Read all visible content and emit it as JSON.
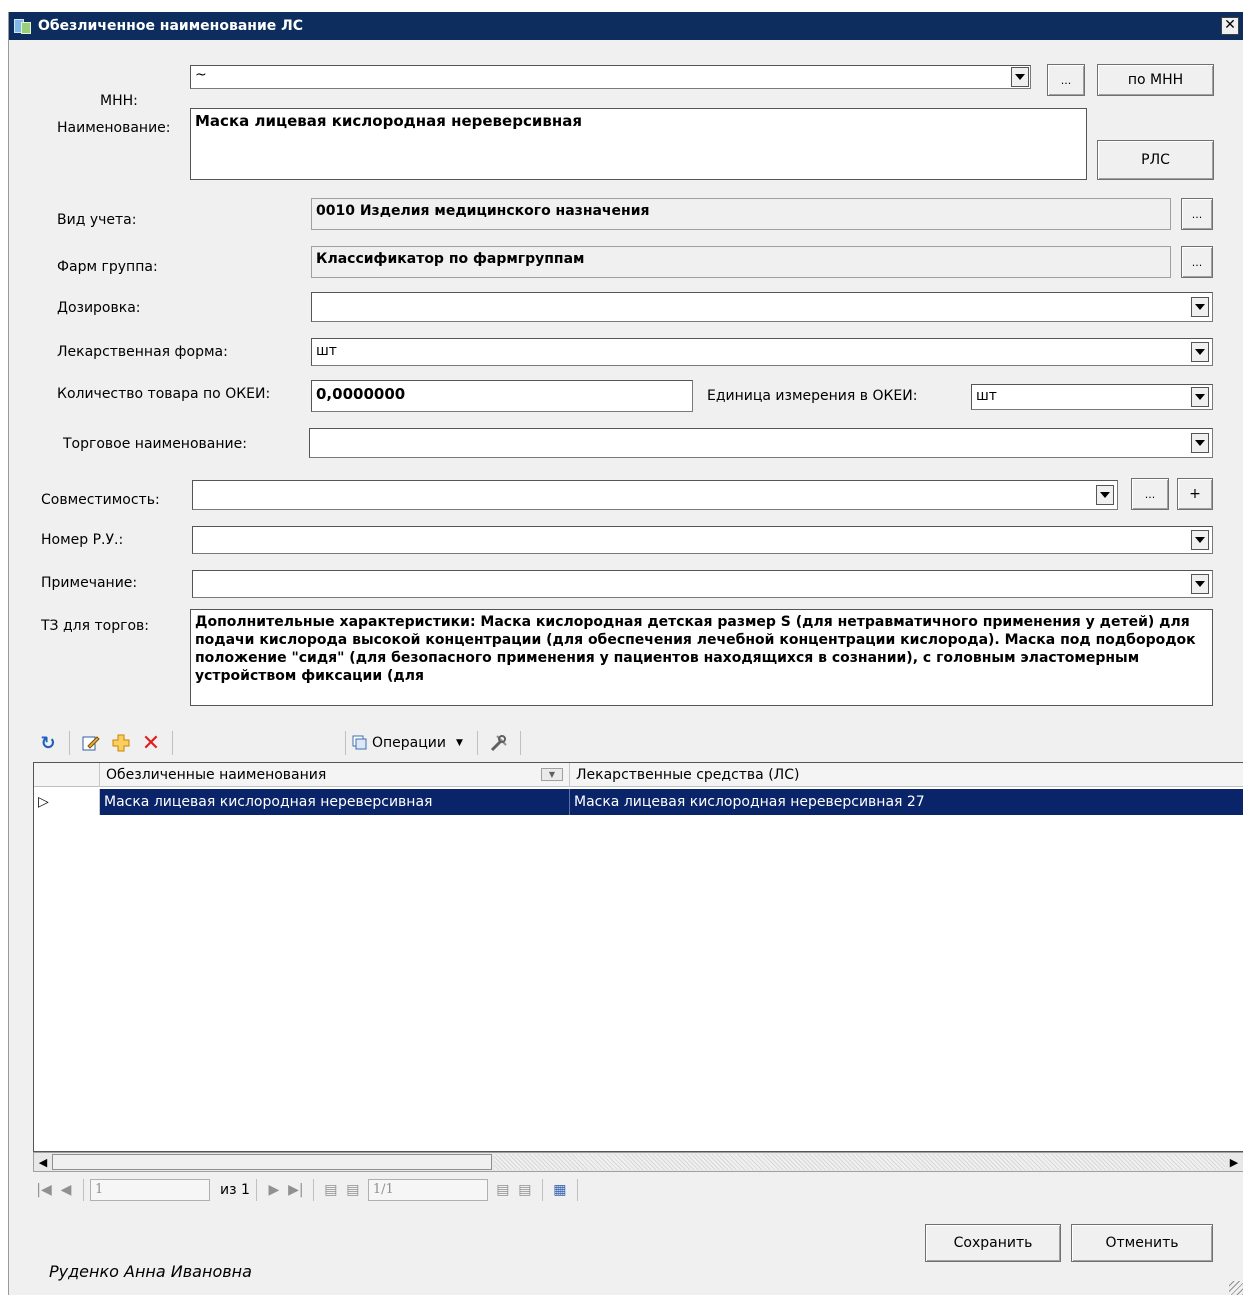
{
  "window": {
    "title": "Обезличенное наименование ЛС",
    "close": "✕"
  },
  "form": {
    "mnn": {
      "label": "МНН:",
      "value": "~",
      "browse": "...",
      "button": "по МНН"
    },
    "name": {
      "label": "Наименование:",
      "value": "Маска лицевая кислородная нереверсивная",
      "button": "РЛС"
    },
    "account_type": {
      "label": "Вид учета:",
      "value": "0010 Изделия медицинского назначения",
      "browse": "..."
    },
    "pharm_group": {
      "label": "Фарм группа:",
      "value": "Классификатор по фармгруппам",
      "browse": "..."
    },
    "dosage": {
      "label": "Дозировка:",
      "value": ""
    },
    "dosage_form": {
      "label": "Лекарственная форма:",
      "value": "шт"
    },
    "okei_qty": {
      "label": "Количество товара по ОКЕИ:",
      "value": "0,0000000"
    },
    "okei_unit": {
      "label": "Единица измерения в ОКЕИ:",
      "value": "шт"
    },
    "trade_name": {
      "label": "Торговое наименование:",
      "value": ""
    },
    "compat": {
      "label": "Совместимость:",
      "value": "",
      "browse": "...",
      "add": "+"
    },
    "reg_number": {
      "label": "Номер Р.У.:",
      "value": ""
    },
    "note": {
      "label": "Примечание:",
      "value": ""
    },
    "tz": {
      "label": "ТЗ для торгов:",
      "value": "Дополнительные характеристики: Маска кислородная детская размер S (для нетравматичного применения у детей) для подачи кислорода высокой концентрации (для обеспечения лечебной концентрации кислорода). Маска под подбородок положение \"сидя\" (для безопасного применения у пациентов находящихся в сознании), с головным эластомерным устройством фиксации (для"
    }
  },
  "toolbar": {
    "operations_label": "Операции",
    "icons": [
      "refresh-icon",
      "edit-icon",
      "add-icon",
      "delete-icon",
      "operations-icon",
      "settings-icon"
    ]
  },
  "grid": {
    "columns": [
      "Обезличенные наименования",
      "Лекарственные средства (ЛС)"
    ],
    "rows": [
      {
        "indicator": "▷",
        "cells": [
          "Маска лицевая кислородная нереверсивная",
          "Маска лицевая кислородная нереверсивная 27"
        ]
      }
    ]
  },
  "pager": {
    "page": "1",
    "of_label": "из 1",
    "record": "1/1"
  },
  "footer": {
    "user": "Руденко Анна Ивановна",
    "save": "Сохранить",
    "cancel": "Отменить"
  },
  "colors": {
    "title_bar": "#0c2d5e",
    "selection": "#0a246a",
    "delete_red": "#e02020",
    "add_orange": "#f0a020"
  }
}
